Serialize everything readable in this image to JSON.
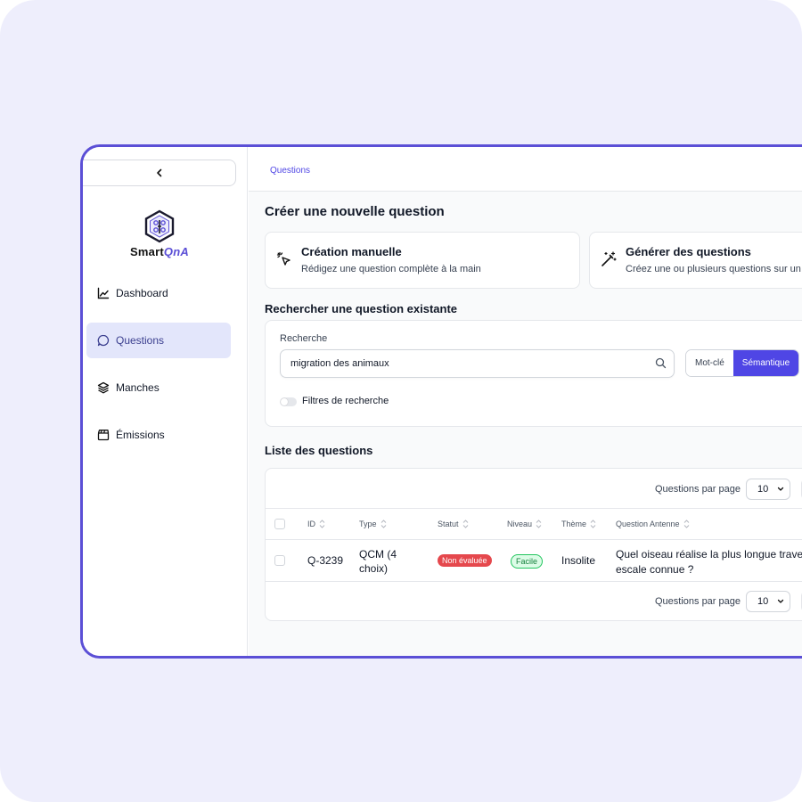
{
  "sidebar": {
    "logo": {
      "prefix": "Smart",
      "accent": "QnA"
    },
    "items": [
      {
        "label": "Dashboard",
        "icon": "chart-line-icon"
      },
      {
        "label": "Questions",
        "icon": "message-circle-icon"
      },
      {
        "label": "Manches",
        "icon": "layers-icon"
      },
      {
        "label": "Émissions",
        "icon": "clapperboard-icon"
      }
    ]
  },
  "breadcrumb": "Questions",
  "create": {
    "title": "Créer une nouvelle question",
    "manual": {
      "title": "Création manuelle",
      "desc": "Rédigez une question complète à la main"
    },
    "generate": {
      "title": "Générer des questions",
      "desc": "Créez une ou plusieurs questions sur un"
    }
  },
  "search": {
    "title": "Rechercher une question existante",
    "label": "Recherche",
    "value": "migration des animaux",
    "mode_keyword": "Mot-clé",
    "mode_semantic": "Sémantique",
    "filters_label": "Filtres de recherche"
  },
  "list": {
    "title": "Liste des questions",
    "per_page_label": "Questions par page",
    "per_page_value": "10",
    "columns": [
      "ID",
      "Type",
      "Statut",
      "Niveau",
      "Thème",
      "Question Antenne"
    ],
    "rows": [
      {
        "id": "Q-3239",
        "type_line1": "QCM (4",
        "type_line2": "choix)",
        "status": "Non évaluée",
        "level": "Facile",
        "theme": "Insolite",
        "question_line1": "Quel oiseau réalise la plus longue traver",
        "question_line2": "escale connue ?"
      }
    ]
  },
  "colors": {
    "accent": "#4f46e5",
    "frame": "#5b4fd6",
    "status_red": "#e5484d",
    "level_green": "#22c55e"
  }
}
